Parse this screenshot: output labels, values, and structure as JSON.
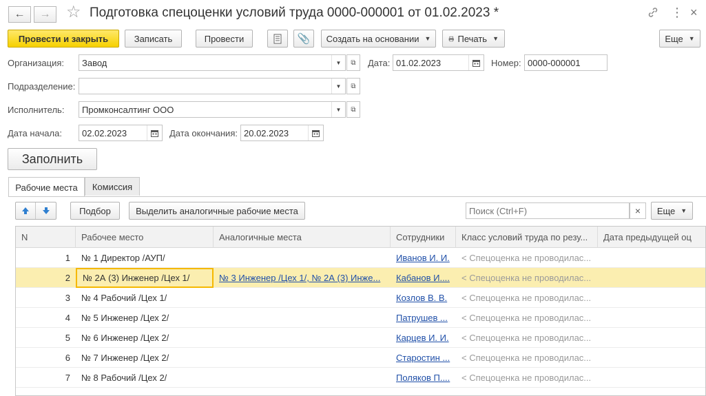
{
  "window": {
    "title": "Подготовка спецоценки условий труда 0000-000001 от 01.02.2023 *"
  },
  "toolbar": {
    "post_close": "Провести и закрыть",
    "save": "Записать",
    "post": "Провести",
    "create_based": "Создать на основании",
    "print": "Печать",
    "more": "Еще"
  },
  "form": {
    "org_label": "Организация:",
    "org_value": "Завод",
    "date_label": "Дата:",
    "date_value": "01.02.2023",
    "number_label": "Номер:",
    "number_value": "0000-000001",
    "dept_label": "Подразделение:",
    "dept_value": "",
    "executor_label": "Исполнитель:",
    "executor_value": "Промконсалтинг ООО",
    "start_label": "Дата начала:",
    "start_value": "02.02.2023",
    "end_label": "Дата окончания:",
    "end_value": "20.02.2023",
    "fill_button": "Заполнить"
  },
  "tabs": [
    {
      "label": "Рабочие места",
      "active": true
    },
    {
      "label": "Комиссия",
      "active": false
    }
  ],
  "table_toolbar": {
    "pick": "Подбор",
    "highlight": "Выделить аналогичные рабочие места",
    "search_placeholder": "Поиск (Ctrl+F)",
    "clear": "×",
    "more": "Еще"
  },
  "table": {
    "columns": [
      "N",
      "Рабочее место",
      "Аналогичные места",
      "Сотрудники",
      "Класс условий труда по резу...",
      "Дата предыдущей оц"
    ],
    "rows": [
      {
        "n": "1",
        "place": "№ 1 Директор /АУП/",
        "similar": "",
        "employee": "Иванов И. И.",
        "class": "< Спецоценка не проводилас...",
        "date": ""
      },
      {
        "n": "2",
        "place": "№ 2А (3) Инженер /Цех 1/",
        "similar": "№ 3 Инженер /Цех 1/, № 2А (3) Инже...",
        "employee": "Кабанов И....",
        "class": "< Спецоценка не проводилас...",
        "date": ""
      },
      {
        "n": "3",
        "place": "№ 4 Рабочий /Цех 1/",
        "similar": "",
        "employee": "Козлов В. В.",
        "class": "< Спецоценка не проводилас...",
        "date": ""
      },
      {
        "n": "4",
        "place": "№ 5 Инженер /Цех 2/",
        "similar": "",
        "employee": "Патрушев ...",
        "class": "< Спецоценка не проводилас...",
        "date": ""
      },
      {
        "n": "5",
        "place": "№ 6 Инженер /Цех 2/",
        "similar": "",
        "employee": "Карцев И. И.",
        "class": "< Спецоценка не проводилас...",
        "date": ""
      },
      {
        "n": "6",
        "place": "№ 7 Инженер /Цех 2/",
        "similar": "",
        "employee": "Старостин ...",
        "class": "< Спецоценка не проводилас...",
        "date": ""
      },
      {
        "n": "7",
        "place": "№ 8 Рабочий /Цех 2/",
        "similar": "",
        "employee": "Поляков П....",
        "class": "< Спецоценка не проводилас...",
        "date": ""
      }
    ],
    "selected_row": 2
  },
  "icons": {
    "back": "arrow-left-icon",
    "forward": "arrow-right-icon",
    "favorite": "star-icon",
    "link": "link-icon",
    "menu": "more-vertical-icon",
    "close": "close-icon"
  },
  "colors": {
    "primary_button": "#f6d100",
    "selected_row": "#fbeeb0",
    "link": "#1f4fa8",
    "arrow_blue": "#2f7fd0"
  }
}
